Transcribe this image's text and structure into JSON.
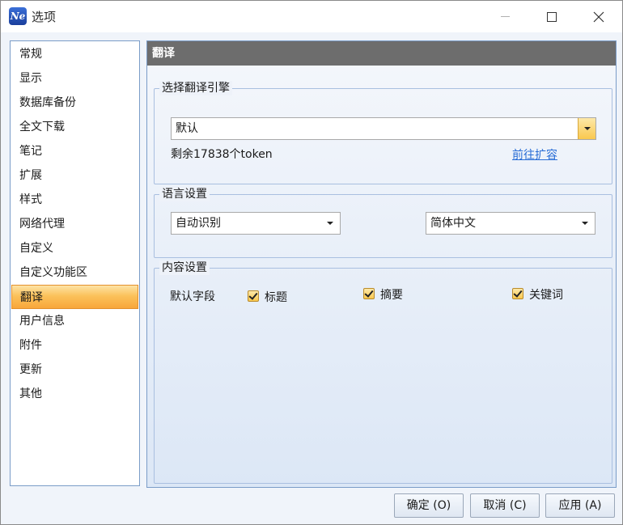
{
  "window": {
    "title": "选项",
    "app_icon_text": "Ne"
  },
  "sidebar": {
    "items": [
      {
        "label": "常规"
      },
      {
        "label": "显示"
      },
      {
        "label": "数据库备份"
      },
      {
        "label": "全文下载"
      },
      {
        "label": "笔记"
      },
      {
        "label": "扩展"
      },
      {
        "label": "样式"
      },
      {
        "label": "网络代理"
      },
      {
        "label": "自定义"
      },
      {
        "label": "自定义功能区"
      },
      {
        "label": "翻译",
        "active": true
      },
      {
        "label": "用户信息"
      },
      {
        "label": "附件"
      },
      {
        "label": "更新"
      },
      {
        "label": "其他"
      }
    ]
  },
  "panel": {
    "header": "翻译",
    "engine_group": {
      "title": "选择翻译引擎",
      "selected": "默认",
      "token_text": "剩余17838个token",
      "expand_link": "前往扩容"
    },
    "language_group": {
      "title": "语言设置",
      "source": "自动识别",
      "target": "简体中文"
    },
    "content_group": {
      "title": "内容设置",
      "field_label": "默认字段",
      "options": [
        {
          "label": "标题",
          "checked": true
        },
        {
          "label": "摘要",
          "checked": true
        },
        {
          "label": "关键词",
          "checked": true
        }
      ]
    }
  },
  "buttons": {
    "ok": "确定 (O)",
    "cancel": "取消 (C)",
    "apply": "应用 (A)"
  }
}
